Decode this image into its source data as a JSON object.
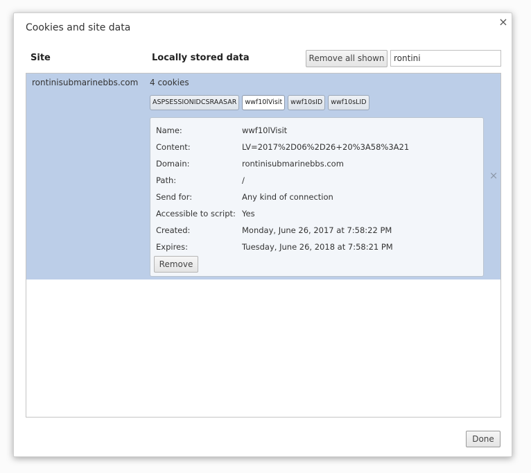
{
  "dialog": {
    "title": "Cookies and site data",
    "close_glyph": "×",
    "columns": {
      "site": "Site",
      "data": "Locally stored data"
    },
    "remove_all_label": "Remove all shown",
    "search_value": "rontini",
    "done_label": "Done",
    "row_delete_glyph": "×"
  },
  "site_row": {
    "site": "rontinisubmarinebbs.com",
    "count_text": "4 cookies",
    "cookies": [
      {
        "name": "ASPSESSIONIDCSRAASAR",
        "active": false
      },
      {
        "name": "wwf10lVisit",
        "active": true
      },
      {
        "name": "wwf10sID",
        "active": false
      },
      {
        "name": "wwf10sLID",
        "active": false
      }
    ],
    "details": {
      "name_label": "Name:",
      "name_value": "wwf10lVisit",
      "content_label": "Content:",
      "content_value": "LV=2017%2D06%2D26+20%3A58%3A21",
      "domain_label": "Domain:",
      "domain_value": "rontinisubmarinebbs.com",
      "path_label": "Path:",
      "path_value": "/",
      "sendfor_label": "Send for:",
      "sendfor_value": "Any kind of connection",
      "script_label": "Accessible to script:",
      "script_value": "Yes",
      "created_label": "Created:",
      "created_value": "Monday, June 26, 2017 at 7:58:22 PM",
      "expires_label": "Expires:",
      "expires_value": "Tuesday, June 26, 2018 at 7:58:21 PM",
      "remove_label": "Remove"
    }
  }
}
